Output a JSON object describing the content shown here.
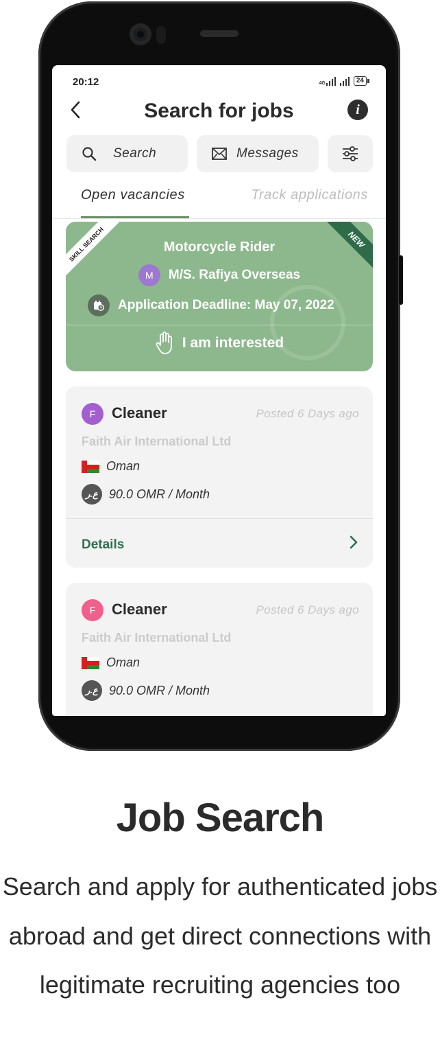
{
  "status_bar": {
    "time": "20:12",
    "network": "4G",
    "battery": "24"
  },
  "header": {
    "title": "Search for jobs"
  },
  "toolbar": {
    "search_label": "Search",
    "messages_label": "Messages"
  },
  "tabs": [
    {
      "label": "Open vacancies",
      "active": true
    },
    {
      "label": "Track applications",
      "active": false
    }
  ],
  "featured": {
    "badge_left": "SKILL SEARCH",
    "badge_right": "NEW",
    "title": "Motorcycle Rider",
    "company_initial": "M",
    "company": "M/S. Rafiya Overseas",
    "deadline": "Application Deadline: May 07, 2022",
    "action_label": "I am interested",
    "bg_color": "#8db88d"
  },
  "jobs": [
    {
      "initial": "F",
      "avatar_color": "#a35fd0",
      "title": "Cleaner",
      "posted": "Posted 6 Days  ago",
      "company": "Faith Air International Ltd",
      "country": "Oman",
      "currency_symbol": "ع.ر",
      "salary": "90.0 OMR / Month",
      "details_label": "Details"
    },
    {
      "initial": "F",
      "avatar_color": "#f0608b",
      "title": "Cleaner",
      "posted": "Posted 6 Days  ago",
      "company": "Faith Air International Ltd",
      "country": "Oman",
      "currency_symbol": "ع.ر",
      "salary": "90.0 OMR / Month"
    }
  ],
  "promo": {
    "title": "Job Search",
    "description": "Search and apply for authenticated jobs abroad and get direct connections with legitimate recruiting agencies too"
  },
  "icons": [
    "back-icon",
    "info-icon",
    "search-icon",
    "mail-icon",
    "filter-icon",
    "calendar-clock-icon",
    "hand-icon",
    "oman-flag-icon",
    "currency-icon",
    "chevron-right-icon"
  ]
}
